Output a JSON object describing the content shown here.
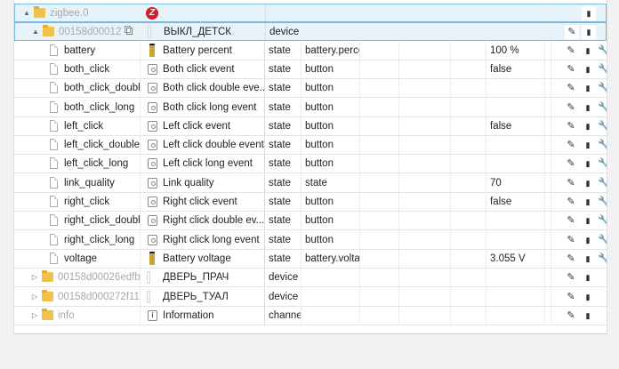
{
  "rows": [
    {
      "name": "zigbee.0",
      "name_grey": true,
      "level": 0,
      "toggle": "open",
      "kind": "folder",
      "desc_icon": "zigbee-logo-icon",
      "desc": "",
      "type": "",
      "role": "",
      "value": "",
      "actions": [
        "delete"
      ],
      "highlight": true
    },
    {
      "name": "00158d00012",
      "name_grey": true,
      "level": 1,
      "toggle": "open",
      "kind": "folder",
      "copy": true,
      "desc_icon": "device-image-icon",
      "desc": "ВЫКЛ_ДЕТСК",
      "type": "device",
      "role": "",
      "value": "",
      "actions": [
        "edit",
        "delete"
      ],
      "highlight": true
    },
    {
      "name": "battery",
      "level": 2,
      "kind": "state",
      "desc_icon": "battery-icon",
      "desc": "Battery percent",
      "type": "state",
      "role": "battery.perce",
      "value": "100 %",
      "actions": [
        "edit",
        "delete",
        "wrench"
      ]
    },
    {
      "name": "both_click",
      "level": 2,
      "kind": "state",
      "desc_icon": "button-icon",
      "desc": "Both click event",
      "type": "state",
      "role": "button",
      "value": "false",
      "actions": [
        "edit",
        "delete",
        "wrench"
      ]
    },
    {
      "name": "both_click_double",
      "level": 2,
      "kind": "state",
      "desc_icon": "button-icon",
      "desc": "Both click double eve...",
      "type": "state",
      "role": "button",
      "value": "",
      "actions": [
        "edit",
        "delete",
        "wrench"
      ]
    },
    {
      "name": "both_click_long",
      "level": 2,
      "kind": "state",
      "desc_icon": "button-icon",
      "desc": "Both click long event",
      "type": "state",
      "role": "button",
      "value": "",
      "actions": [
        "edit",
        "delete",
        "wrench"
      ]
    },
    {
      "name": "left_click",
      "level": 2,
      "kind": "state",
      "desc_icon": "button-icon",
      "desc": "Left click event",
      "type": "state",
      "role": "button",
      "value": "false",
      "actions": [
        "edit",
        "delete",
        "wrench"
      ]
    },
    {
      "name": "left_click_double",
      "level": 2,
      "kind": "state",
      "desc_icon": "button-icon",
      "desc": "Left click double event",
      "type": "state",
      "role": "button",
      "value": "",
      "actions": [
        "edit",
        "delete",
        "wrench"
      ]
    },
    {
      "name": "left_click_long",
      "level": 2,
      "kind": "state",
      "desc_icon": "button-icon",
      "desc": "Left click long event",
      "type": "state",
      "role": "button",
      "value": "",
      "actions": [
        "edit",
        "delete",
        "wrench"
      ]
    },
    {
      "name": "link_quality",
      "level": 2,
      "kind": "state",
      "desc_icon": "button-icon",
      "desc": "Link quality",
      "type": "state",
      "role": "state",
      "value": "70",
      "actions": [
        "edit",
        "delete",
        "wrench"
      ]
    },
    {
      "name": "right_click",
      "level": 2,
      "kind": "state",
      "desc_icon": "button-icon",
      "desc": "Right click event",
      "type": "state",
      "role": "button",
      "value": "false",
      "actions": [
        "edit",
        "delete",
        "wrench"
      ]
    },
    {
      "name": "right_click_double",
      "level": 2,
      "kind": "state",
      "desc_icon": "button-icon",
      "desc": "Right click double ev...",
      "type": "state",
      "role": "button",
      "value": "",
      "actions": [
        "edit",
        "delete",
        "wrench"
      ]
    },
    {
      "name": "right_click_long",
      "level": 2,
      "kind": "state",
      "desc_icon": "button-icon",
      "desc": "Right click long event",
      "type": "state",
      "role": "button",
      "value": "",
      "actions": [
        "edit",
        "delete",
        "wrench"
      ]
    },
    {
      "name": "voltage",
      "level": 2,
      "kind": "state",
      "desc_icon": "battery-icon",
      "desc": "Battery voltage",
      "type": "state",
      "role": "battery.voltag",
      "value": "3.055 V",
      "actions": [
        "edit",
        "delete",
        "wrench"
      ]
    },
    {
      "name": "00158d00026edfb",
      "name_grey": true,
      "level": 1,
      "toggle": "closed",
      "kind": "folder",
      "desc_icon": "device-image-icon",
      "desc": "ДВЕРЬ_ПРАЧ",
      "type": "device",
      "role": "",
      "value": "",
      "actions": [
        "edit",
        "delete"
      ]
    },
    {
      "name": "00158d000272f11",
      "name_grey": true,
      "level": 1,
      "toggle": "closed",
      "kind": "folder",
      "desc_icon": "device-image-icon",
      "desc": "ДВЕРЬ_ТУАЛ",
      "type": "device",
      "role": "",
      "value": "",
      "actions": [
        "edit",
        "delete"
      ]
    },
    {
      "name": "info",
      "name_grey": true,
      "level": 1,
      "toggle": "closed",
      "kind": "folder",
      "desc_icon": "info-icon",
      "desc": "Information",
      "type": "channe",
      "role": "",
      "value": "",
      "actions": [
        "edit",
        "delete"
      ]
    }
  ],
  "icons": {
    "open": "▲",
    "closed": "▷",
    "edit": "✎",
    "delete": "▮",
    "wrench": "🔧"
  },
  "colors": {
    "accent_border": "#79b8e2",
    "highlight_bg": "#e7f3fb",
    "folder": "#f0c24b",
    "zigbee_logo": "#d51d29"
  }
}
